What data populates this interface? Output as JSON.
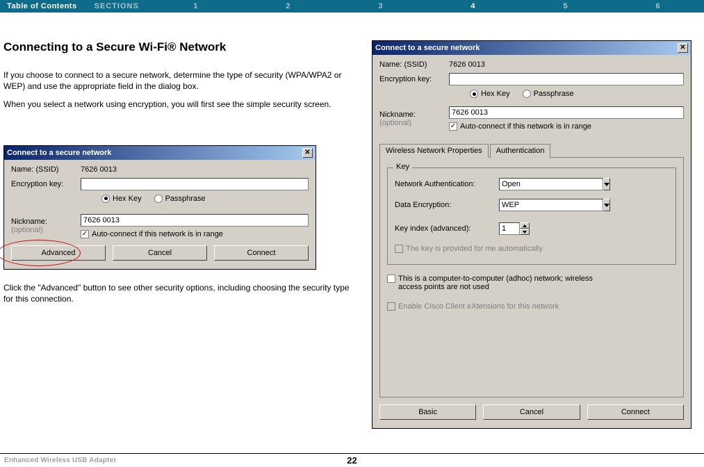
{
  "nav": {
    "toc": "Table of Contents",
    "sections": "SECTIONS",
    "items": [
      "1",
      "2",
      "3",
      "4",
      "5",
      "6"
    ],
    "active_index": 3
  },
  "heading": "Connecting to a Secure Wi-Fi® Network",
  "para1": "If you choose to connect to a secure network, determine the type of security (WPA/WPA2 or WEP) and use the appropriate field in the dialog box.",
  "para2": "When you select a network using encryption, you will first see the simple security screen.",
  "para3": "Click the \"Advanced\" button to see other security options, including choosing the security type for this connection.",
  "dialog1": {
    "title": "Connect to a secure network",
    "name_label": "Name:   (SSID)",
    "name_value": "7626 0013",
    "enc_label": "Encryption key:",
    "enc_value": "",
    "hex": "Hex Key",
    "pass": "Passphrase",
    "nick_label": "Nickname:",
    "optional": "(optional)",
    "nick_value": "7626 0013",
    "auto": "Auto-connect if this network is in range",
    "btn_adv": "Advanced",
    "btn_cancel": "Cancel",
    "btn_connect": "Connect"
  },
  "dialog2": {
    "title": "Connect to a secure network",
    "name_label": "Name:   (SSID)",
    "name_value": "7626 0013",
    "enc_label": "Encryption key:",
    "enc_value": "",
    "hex": "Hex Key",
    "pass": "Passphrase",
    "nick_label": "Nickname:",
    "optional": "(optional)",
    "nick_value": "7626 0013",
    "auto": "Auto-connect if this network is in range",
    "tab_wnp": "Wireless Network Properties",
    "tab_auth": "Authentication",
    "group_key": "Key",
    "netauth": "Network Authentication:",
    "netauth_val": "Open",
    "dataenc": "Data Encryption:",
    "dataenc_val": "WEP",
    "keyidx": "Key index (advanced):",
    "keyidx_val": "1",
    "key_auto": "The key is provided for me automatically",
    "adhoc": "This is a computer-to-computer (adhoc) network; wireless access points are not used",
    "cisco": "Enable Cisco Client eXtensions for this network",
    "btn_basic": "Basic",
    "btn_cancel": "Cancel",
    "btn_connect": "Connect"
  },
  "footer": {
    "product": "Enhanced Wireless USB Adapter",
    "page": "22"
  }
}
